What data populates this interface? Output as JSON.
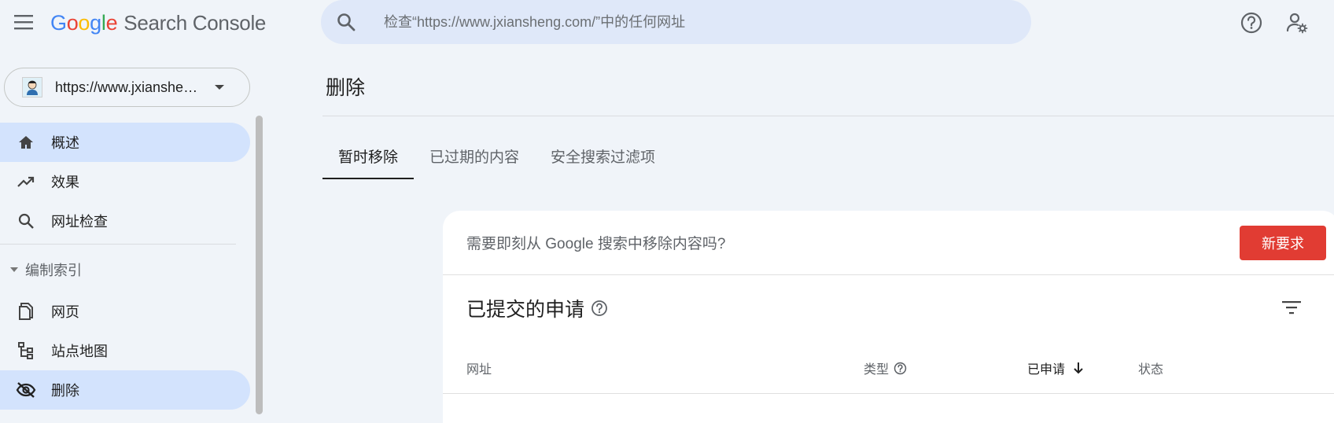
{
  "header": {
    "logo_letters": [
      "G",
      "o",
      "o",
      "g",
      "l",
      "e"
    ],
    "product": "Search Console",
    "search_placeholder": "检查“https://www.jxiansheng.com/”中的任何网址"
  },
  "property": {
    "url": "https://www.jxiansheng.com/"
  },
  "sidebar": {
    "items": [
      {
        "label": "概述",
        "icon": "home-icon",
        "active": true
      },
      {
        "label": "效果",
        "icon": "trending-up-icon",
        "active": false
      },
      {
        "label": "网址检查",
        "icon": "search-icon",
        "active": false
      }
    ],
    "section": {
      "label": "编制索引",
      "icon": "caret-down-icon"
    },
    "index_items": [
      {
        "label": "网页",
        "icon": "pages-icon",
        "active": false
      },
      {
        "label": "站点地图",
        "icon": "sitemap-icon",
        "active": false
      },
      {
        "label": "删除",
        "icon": "visibility-off-icon",
        "active": true
      }
    ]
  },
  "main": {
    "title": "删除",
    "tabs": [
      "暂时移除",
      "已过期的内容",
      "安全搜索过滤项"
    ],
    "active_tab": 0,
    "card": {
      "question": "需要即刻从 Google 搜索中移除内容吗?",
      "new_request": "新要求",
      "submitted_title": "已提交的申请",
      "columns": {
        "url": "网址",
        "type": "类型",
        "requested": "已申请",
        "status": "状态"
      }
    }
  },
  "colors": {
    "accent_active_bg": "#d3e3fd",
    "search_bg": "#dfe8f9",
    "new_request_bg": "#e13c33",
    "page_bg": "#f0f4f9"
  }
}
